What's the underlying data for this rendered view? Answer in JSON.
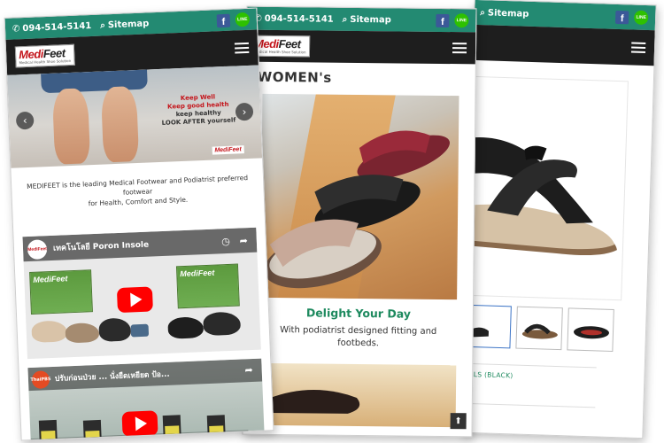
{
  "topbar": {
    "phone": "094-514-5141",
    "sitemap": "Sitemap",
    "fb_letter": "f",
    "line_text": "LINE"
  },
  "logo": {
    "brand_red": "Medi",
    "brand_dark": "Feet",
    "tagline": "Medical Health Shoe Solution"
  },
  "phone1": {
    "hero": {
      "tag_lines": [
        "Keep Well",
        "Keep good health",
        "keep healthy",
        "LOOK AFTER yourself"
      ],
      "mini_logo": "MediFeet",
      "prev": "‹",
      "next": "›"
    },
    "intro": "MEDIFEET is the leading Medical Footwear and Podiatrist preferred footwear",
    "intro2": "for Health, Comfort and Style.",
    "video1": {
      "title": "เทคโนโลยี Poron Insole",
      "channel": "MediFeet",
      "box_label_1": "MediFeet",
      "box_label_2": "MediFeet"
    },
    "video2": {
      "title": "ปรับก่อนป่วย ... นั่งยืดเหยียด ป้อ...",
      "channel": "ThaiPBS"
    }
  },
  "phone2": {
    "section_title": "WOMEN's",
    "headline": "Delight Your Day",
    "subline": "With podiatrist designed fitting and footbeds.",
    "to_top": "⬆"
  },
  "phone3": {
    "product_name": "DALS (BLACK)"
  },
  "colors": {
    "accent_green": "#238a72",
    "nav_dark": "#1e1e1e",
    "headline_green": "#1e8a5f",
    "brand_red": "#c4161c"
  }
}
